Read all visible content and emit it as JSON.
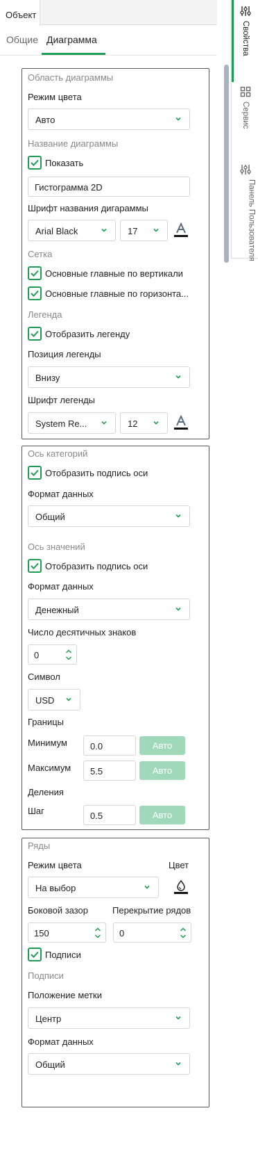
{
  "tabs": {
    "object": "Объект"
  },
  "subtabs": {
    "general": "Общие",
    "chart": "Диаграмма"
  },
  "side_panel": {
    "items": [
      {
        "label": "Свойства",
        "icon": "sliders-icon"
      },
      {
        "label": "Сервис",
        "icon": "grid-icon"
      },
      {
        "label": "Панель Пользователя",
        "icon": "sliders-icon"
      }
    ]
  },
  "chart_area": {
    "title": "Область диаграммы",
    "color_mode_label": "Режим цвета",
    "color_mode_value": "Авто",
    "chart_name_section": "Название диаграммы",
    "show_label": "Показать",
    "chart_name_value": "Гистограмма 2D",
    "title_font_label": "Шрифт названия дигараммы",
    "title_font_value": "Arial Black",
    "title_font_size": "17",
    "grid_section": "Сетка",
    "grid_vertical": "Основные главные по вертикали",
    "grid_horizontal": "Основные главные по горизонта...",
    "legend_section": "Легенда",
    "legend_show": "Отобразить легенду",
    "legend_position_label": "Позиция легенды",
    "legend_position_value": "Внизу",
    "legend_font_label": "Шрифт легенды",
    "legend_font_value": "System Re...",
    "legend_font_size": "12"
  },
  "axes": {
    "category_title": "Ось категорий",
    "category_show_label": "Отобразить подпись оси",
    "category_format_label": "Формат данных",
    "category_format_value": "Общий",
    "value_title": "Ось значений",
    "value_show_label": "Отобразить подпись оси",
    "value_format_label": "Формат данных",
    "value_format_value": "Денежный",
    "decimals_label": "Число десятичных знаков",
    "decimals_value": "0",
    "symbol_label": "Символ",
    "symbol_value": "USD",
    "bounds_label": "Границы",
    "min_label": "Минимум",
    "min_value": "0.0",
    "max_label": "Максимум",
    "max_value": "5.5",
    "auto_label": "Авто",
    "divisions_label": "Деления",
    "step_label": "Шаг",
    "step_value": "0.5"
  },
  "series": {
    "title": "Ряды",
    "color_mode_label": "Режим цвета",
    "color_label": "Цвет",
    "color_mode_value": "На выбор",
    "gap_label": "Боковой зазор",
    "gap_value": "150",
    "overlap_label": "Перекрытие рядов",
    "overlap_value": "0",
    "labels_check": "Подписи",
    "labels_section": "Подписи",
    "label_position_label": "Положение метки",
    "label_position_value": "Центр",
    "format_label": "Формат данных",
    "format_value": "Общий"
  },
  "colors": {
    "accent": "#1f9d55",
    "auto_button": "#9fd9b9",
    "border": "#555555"
  }
}
